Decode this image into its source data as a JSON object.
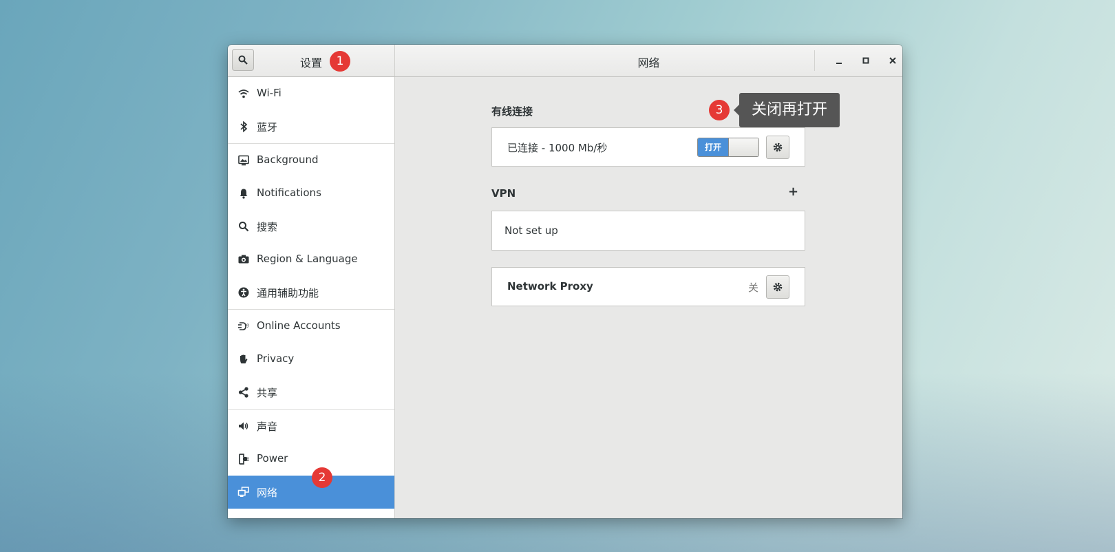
{
  "window": {
    "sidebar_title": "设置",
    "main_title": "网络"
  },
  "sidebar": {
    "items": [
      {
        "label": "Wi-Fi",
        "icon": "wifi-icon"
      },
      {
        "label": "蓝牙",
        "icon": "bluetooth-icon"
      },
      {
        "label": "Background",
        "icon": "background-icon"
      },
      {
        "label": "Notifications",
        "icon": "bell-icon"
      },
      {
        "label": "搜索",
        "icon": "search-icon"
      },
      {
        "label": "Region & Language",
        "icon": "camera-icon"
      },
      {
        "label": "通用辅助功能",
        "icon": "accessibility-icon"
      },
      {
        "label": "Online Accounts",
        "icon": "online-accounts-icon"
      },
      {
        "label": "Privacy",
        "icon": "hand-icon"
      },
      {
        "label": "共享",
        "icon": "share-icon"
      },
      {
        "label": "声音",
        "icon": "speaker-icon"
      },
      {
        "label": "Power",
        "icon": "power-plug-icon"
      },
      {
        "label": "网络",
        "icon": "network-icon",
        "active": true
      }
    ]
  },
  "wired": {
    "section_title": "有线连接",
    "status": "已连接 - 1000 Mb/秒",
    "toggle_on_label": "打开",
    "toggle_state": "on"
  },
  "vpn": {
    "section_title": "VPN",
    "add_label": "+",
    "empty_text": "Not set up"
  },
  "proxy": {
    "label": "Network Proxy",
    "status": "关"
  },
  "annotations": {
    "badge1": "1",
    "badge2": "2",
    "badge3": "3",
    "tooltip": "关闭再打开"
  },
  "colors": {
    "accent": "#4a90d9",
    "badge": "#e53935",
    "tooltip_bg": "#555555"
  }
}
